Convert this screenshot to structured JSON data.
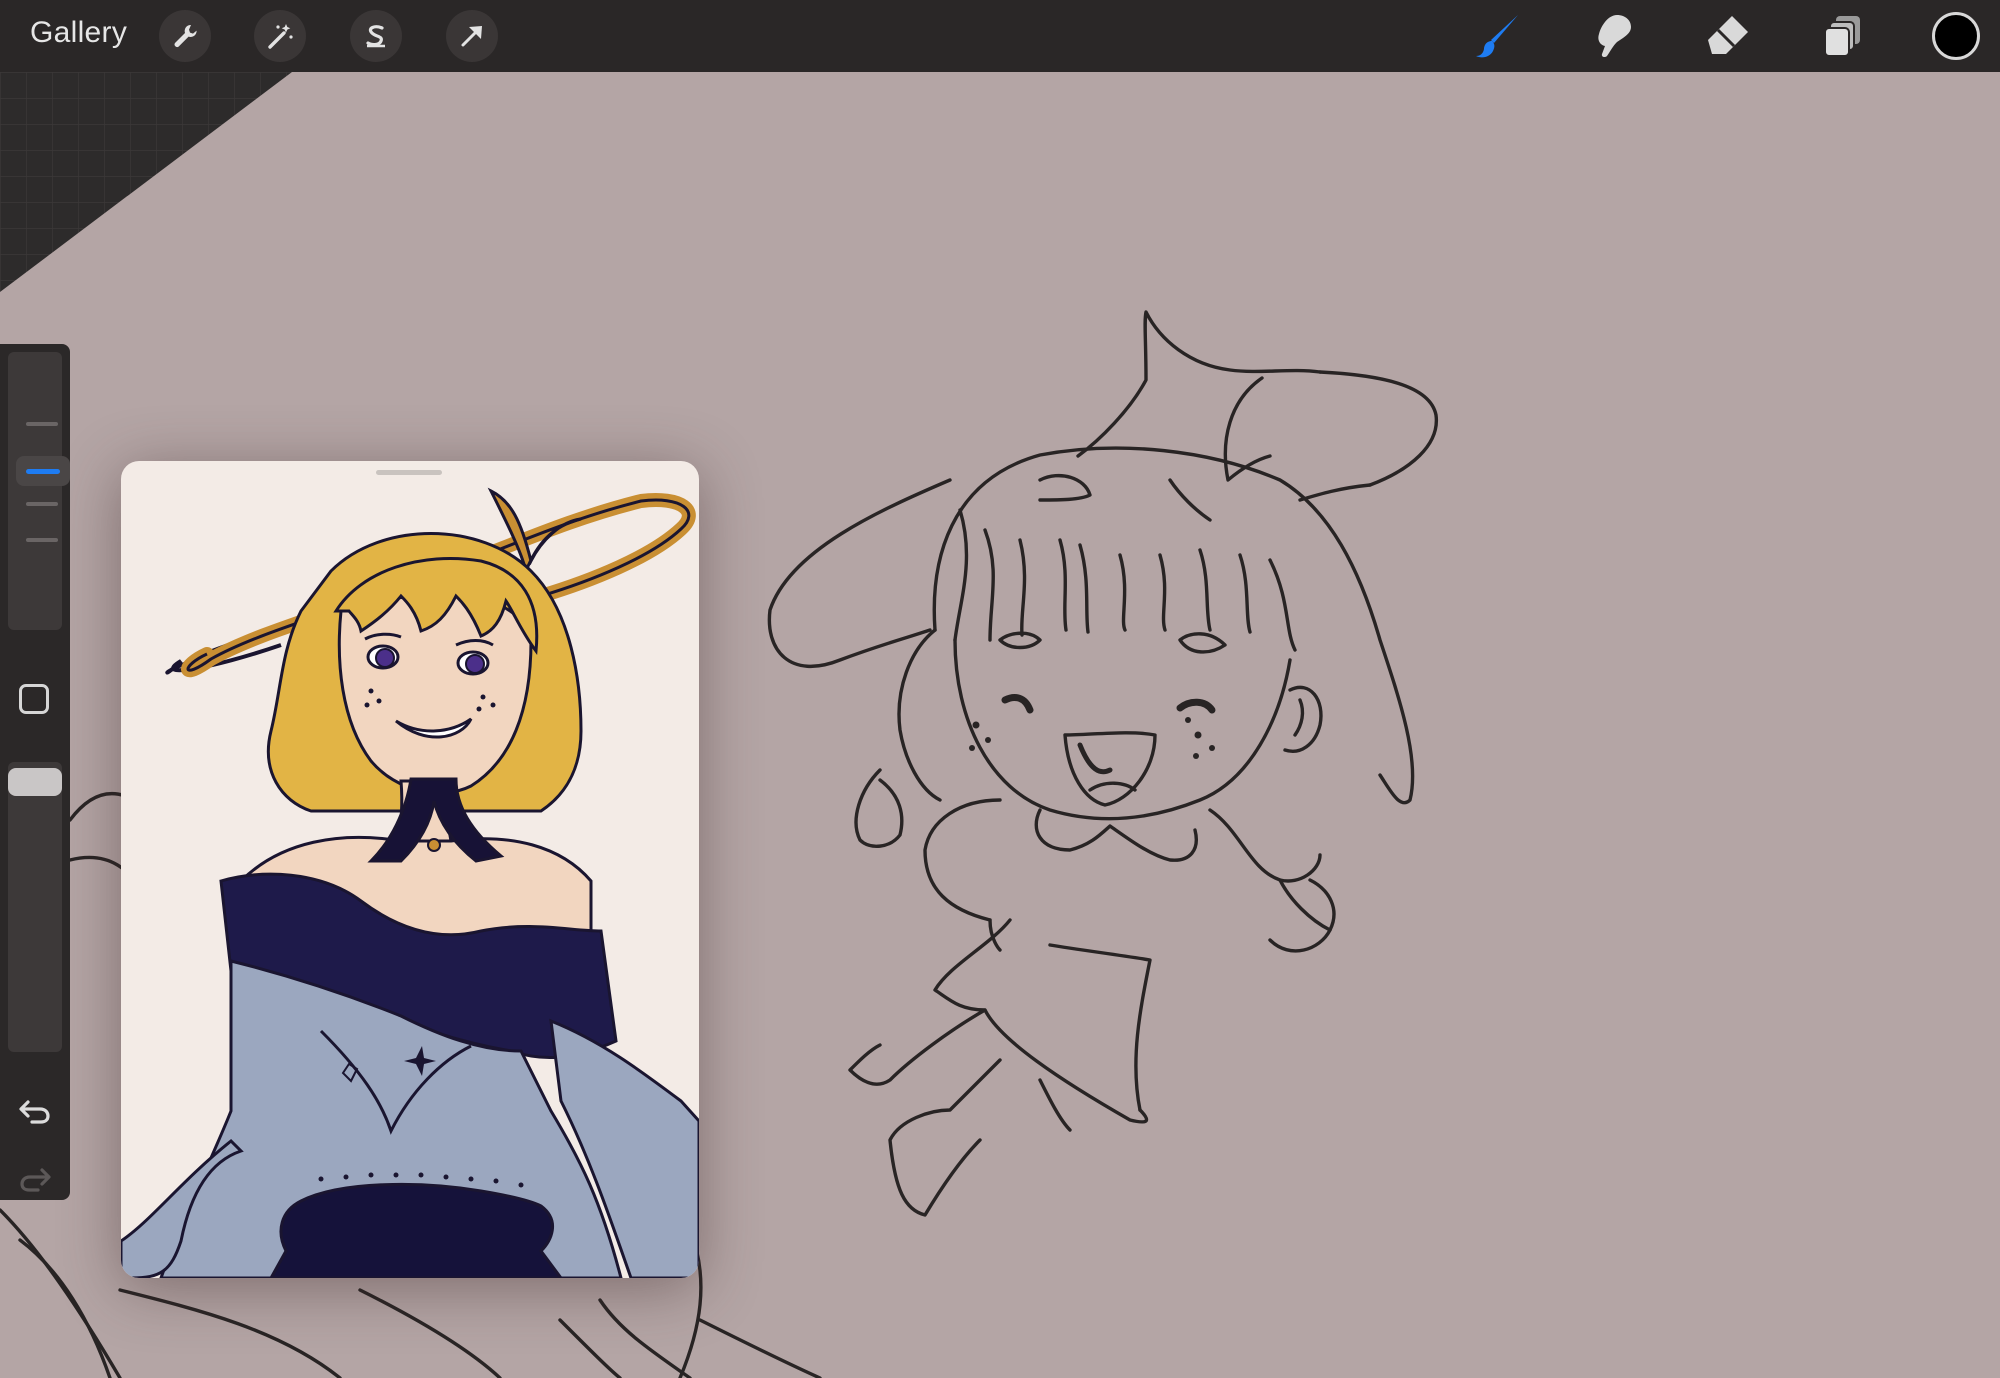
{
  "topbar": {
    "gallery_label": "Gallery",
    "left_tools": [
      "wrench-icon",
      "magic-wand-icon",
      "selection-s-icon",
      "transform-arrow-icon"
    ],
    "right_tools": [
      "brush-icon",
      "smudge-icon",
      "eraser-icon",
      "layers-icon"
    ],
    "active_tool": "brush",
    "accent_color": "#1e7cf2",
    "current_color": "#000000"
  },
  "sidebar": {
    "brush_size_level": 0.3,
    "brush_opacity_level": 1.0
  },
  "canvas": {
    "background_color": "#b4a5a5",
    "reference_window_background": "#f3ebe6"
  }
}
